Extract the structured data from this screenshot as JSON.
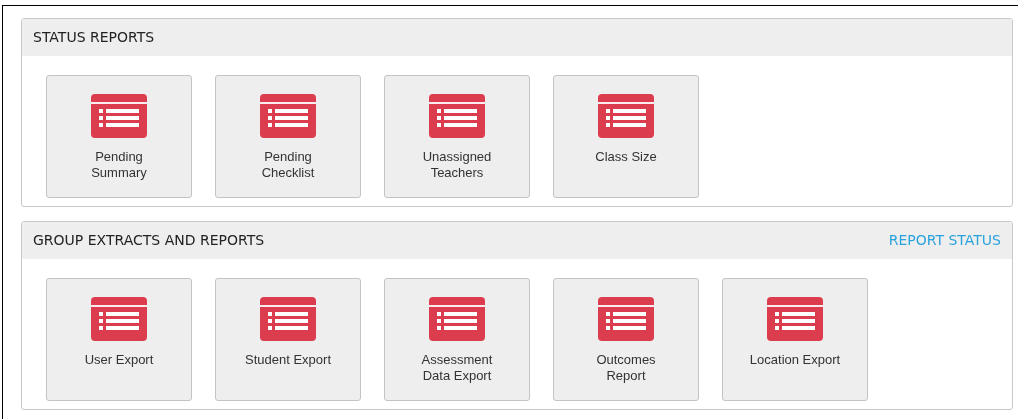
{
  "sections": [
    {
      "title": "STATUS REPORTS",
      "tiles": [
        {
          "label": "Pending Summary"
        },
        {
          "label": "Pending Checklist"
        },
        {
          "label": "Unassigned Teachers"
        },
        {
          "label": "Class Size"
        }
      ]
    },
    {
      "title": "GROUP EXTRACTS AND REPORTS",
      "link": "REPORT STATUS",
      "tiles": [
        {
          "label": "User Export"
        },
        {
          "label": "Student Export"
        },
        {
          "label": "Assessment Data Export"
        },
        {
          "label": "Outcomes Report"
        },
        {
          "label": "Location Export"
        }
      ]
    }
  ]
}
